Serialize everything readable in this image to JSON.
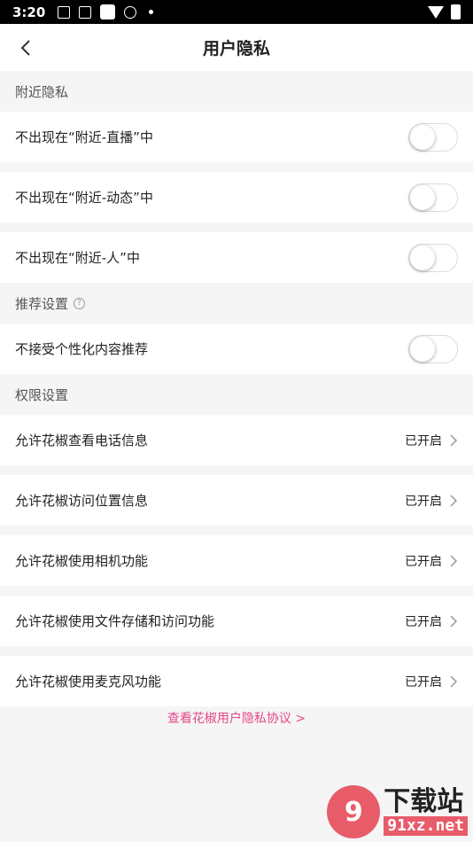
{
  "status_bar": {
    "time": "3:20"
  },
  "nav": {
    "title": "用户隐私"
  },
  "sections": {
    "nearby": {
      "header": "附近隐私",
      "items": [
        {
          "label": "不出现在“附近-直播”中",
          "enabled": false
        },
        {
          "label": "不出现在“附近-动态”中",
          "enabled": false
        },
        {
          "label": "不出现在“附近-人”中",
          "enabled": false
        }
      ]
    },
    "recommend": {
      "header": "推荐设置",
      "items": [
        {
          "label": "不接受个性化内容推荐",
          "enabled": false
        }
      ]
    },
    "permissions": {
      "header": "权限设置",
      "items": [
        {
          "label": "允许花椒查看电话信息",
          "status": "已开启"
        },
        {
          "label": "允许花椒访问位置信息",
          "status": "已开启"
        },
        {
          "label": "允许花椒使用相机功能",
          "status": "已开启"
        },
        {
          "label": "允许花椒使用文件存储和访问功能",
          "status": "已开启"
        },
        {
          "label": "允许花椒使用麦克风功能",
          "status": "已开启"
        }
      ]
    }
  },
  "footer": {
    "privacy_link": "查看花椒用户隐私协议 >"
  },
  "watermark": {
    "logo": "9",
    "main": "下载站",
    "sub": "91xz.net"
  },
  "colors": {
    "accent": "#e5488a",
    "background": "#f5f5f5"
  }
}
